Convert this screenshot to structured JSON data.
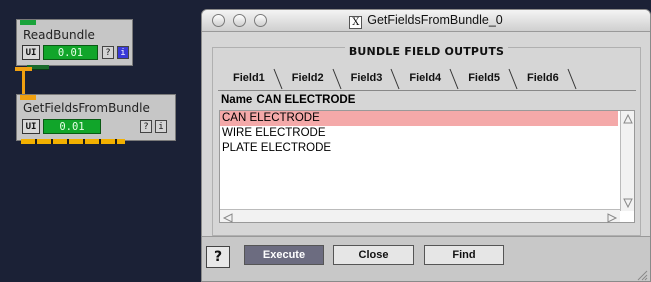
{
  "network": {
    "modules": [
      {
        "title": "ReadBundle",
        "ui_label": "UI",
        "progress": "0.01",
        "help": "?",
        "info": "i"
      },
      {
        "title": "GetFieldsFromBundle",
        "ui_label": "UI",
        "progress": "0.01",
        "help": "?",
        "info": "i"
      }
    ]
  },
  "dialog": {
    "title": "GetFieldsFromBundle_0",
    "group_label": "BUNDLE FIELD OUTPUTS",
    "tabs": [
      {
        "label": "Field1"
      },
      {
        "label": "Field2"
      },
      {
        "label": "Field3"
      },
      {
        "label": "Field4"
      },
      {
        "label": "Field5"
      },
      {
        "label": "Field6"
      }
    ],
    "name_label": "Name",
    "name_value": "CAN ELECTRODE",
    "list_items": [
      "CAN ELECTRODE",
      "WIRE ELECTRODE",
      "PLATE ELECTRODE"
    ],
    "selected_index": 0,
    "buttons": {
      "help": "?",
      "execute": "Execute",
      "close": "Close",
      "find": "Find"
    }
  },
  "colors": {
    "background": "#1b2136",
    "selection": "#f4a9a9",
    "progress": "#11a52a",
    "pipe": "#f0a010",
    "execute": "#6c6c80"
  }
}
